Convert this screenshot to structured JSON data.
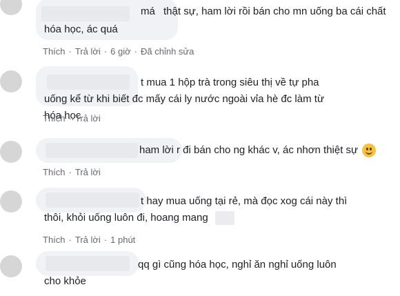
{
  "comments": [
    {
      "text_a": "má",
      "text_b": "thật sự, ham lời rồi bán cho mn uống ba cái chất hóa học, ác quá",
      "like": "Thích",
      "reply": "Trả lời",
      "time": "6 giờ",
      "edited": "Đã chỉnh sửa"
    },
    {
      "text": "t mua 1 hộp trà trong siêu thị về tự pha uống kể từ khi biết đc mấy cái ly nước ngoài vỉa hè đc làm từ hóa học",
      "like": "Thích",
      "reply": "Trả lời"
    },
    {
      "text": "ham lời r đi bán cho ng khác v, ác nhơn thiệt sự",
      "emoji": "smile-emoji",
      "like": "Thích",
      "reply": "Trả lời"
    },
    {
      "text": "t hay mua uống tại rẻ, mà đọc xog cái này thì thôi, khỏi uống luôn đi, hoang mang",
      "like": "Thích",
      "reply": "Trả lời",
      "time": "1 phút"
    },
    {
      "text": "qq gì cũng hóa học, nghỉ ăn nghỉ uống luôn cho khỏe"
    }
  ],
  "colors": {
    "bubble_bg": "#f0f2f5",
    "text": "#1c1e21",
    "meta": "#65676b",
    "avatar": "#d6d6d6"
  }
}
